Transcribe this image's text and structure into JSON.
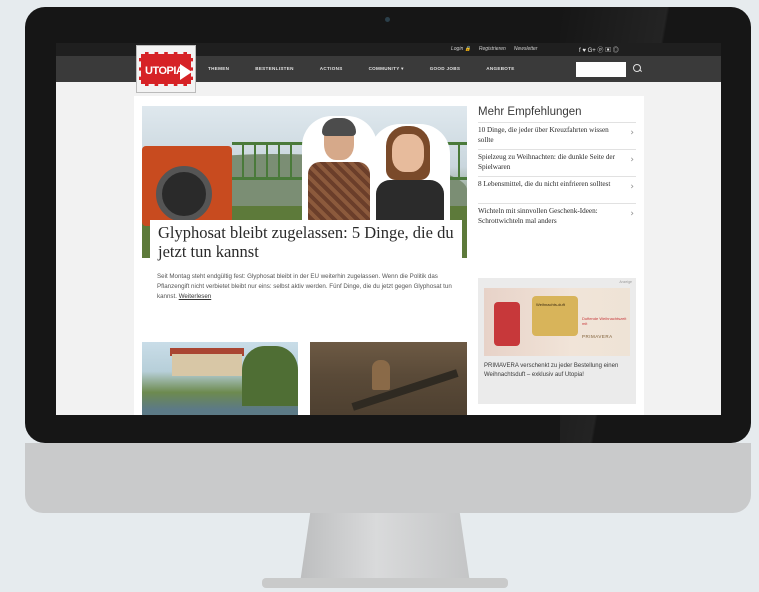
{
  "topbar": {
    "links": [
      "Login 🔒",
      "Registrieren",
      "Newsletter"
    ],
    "social_icons": "f ♥ G+ ⓟ ▣ ◎"
  },
  "brand": {
    "logo_text": "UTOPIA",
    "accent": "#d62226"
  },
  "nav": {
    "items": [
      "THEMEN",
      "BESTENLISTEN",
      "ACTIONS",
      "COMMUNITY ▾",
      "GOOD JOBS",
      "ANGEBOTE"
    ],
    "search_value": ""
  },
  "hero": {
    "headline": "Glyphosat bleibt zugelassen: 5 Dinge, die du jetzt tun kannst",
    "teaser": "Seit Montag steht endgültig fest: Glyphosat bleibt in der EU weiterhin zugelassen. Wenn die Politik das Pflanzengift nicht verbietet bleibt nur eins: selbst aktiv werden. Fünf Dinge, die du jetzt gegen Glyphosat tun kannst.",
    "more_link": "Weiterlesen"
  },
  "sidebar": {
    "title": "Mehr Empfehlungen",
    "items": [
      {
        "label": "10 Dinge, die jeder über Kreuzfahrten wissen sollte"
      },
      {
        "label": "Spielzeug zu Weihnachten: die dunkle Seite der Spielwaren"
      },
      {
        "label": "8 Lebensmittel, die du nicht einfrieren solltest"
      },
      {
        "label": "Wichteln mit sinnvollen Geschenk-Ideen: Schrottwichteln mal anders"
      }
    ]
  },
  "ad": {
    "label": "Anzeige",
    "box_text": "Weihnachts-duft",
    "sub_text": "Duftende Weihnachtszeit mit",
    "brand": "PRIMAVERA",
    "text": "PRIMAVERA verschenkt zu jeder Bestellung einen Weihnachtsduft – exklusiv auf Utopia!"
  }
}
